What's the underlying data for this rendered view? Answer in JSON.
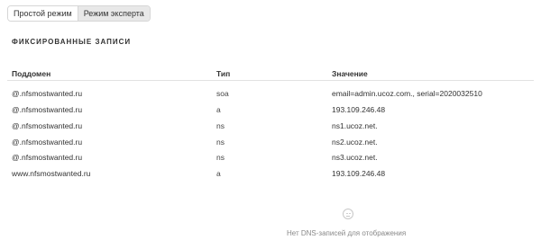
{
  "mode_switch": {
    "simple_label": "Простой режим",
    "expert_label": "Режим эксперта"
  },
  "section_title": "ФИКСИРОВАННЫЕ ЗАПИСИ",
  "table": {
    "columns": [
      "Поддомен",
      "Тип",
      "Значение"
    ],
    "rows": [
      {
        "subdomain": "@.nfsmostwanted.ru",
        "type": "soa",
        "value": "email=admin.ucoz.com., serial=2020032510"
      },
      {
        "subdomain": "@.nfsmostwanted.ru",
        "type": "a",
        "value": "193.109.246.48"
      },
      {
        "subdomain": "@.nfsmostwanted.ru",
        "type": "ns",
        "value": "ns1.ucoz.net."
      },
      {
        "subdomain": "@.nfsmostwanted.ru",
        "type": "ns",
        "value": "ns2.ucoz.net."
      },
      {
        "subdomain": "@.nfsmostwanted.ru",
        "type": "ns",
        "value": "ns3.ucoz.net."
      },
      {
        "subdomain": "www.nfsmostwanted.ru",
        "type": "a",
        "value": "193.109.246.48"
      }
    ]
  },
  "empty_state": {
    "icon": "sad-face-icon",
    "text": "Нет DNS-записей для отображения"
  }
}
